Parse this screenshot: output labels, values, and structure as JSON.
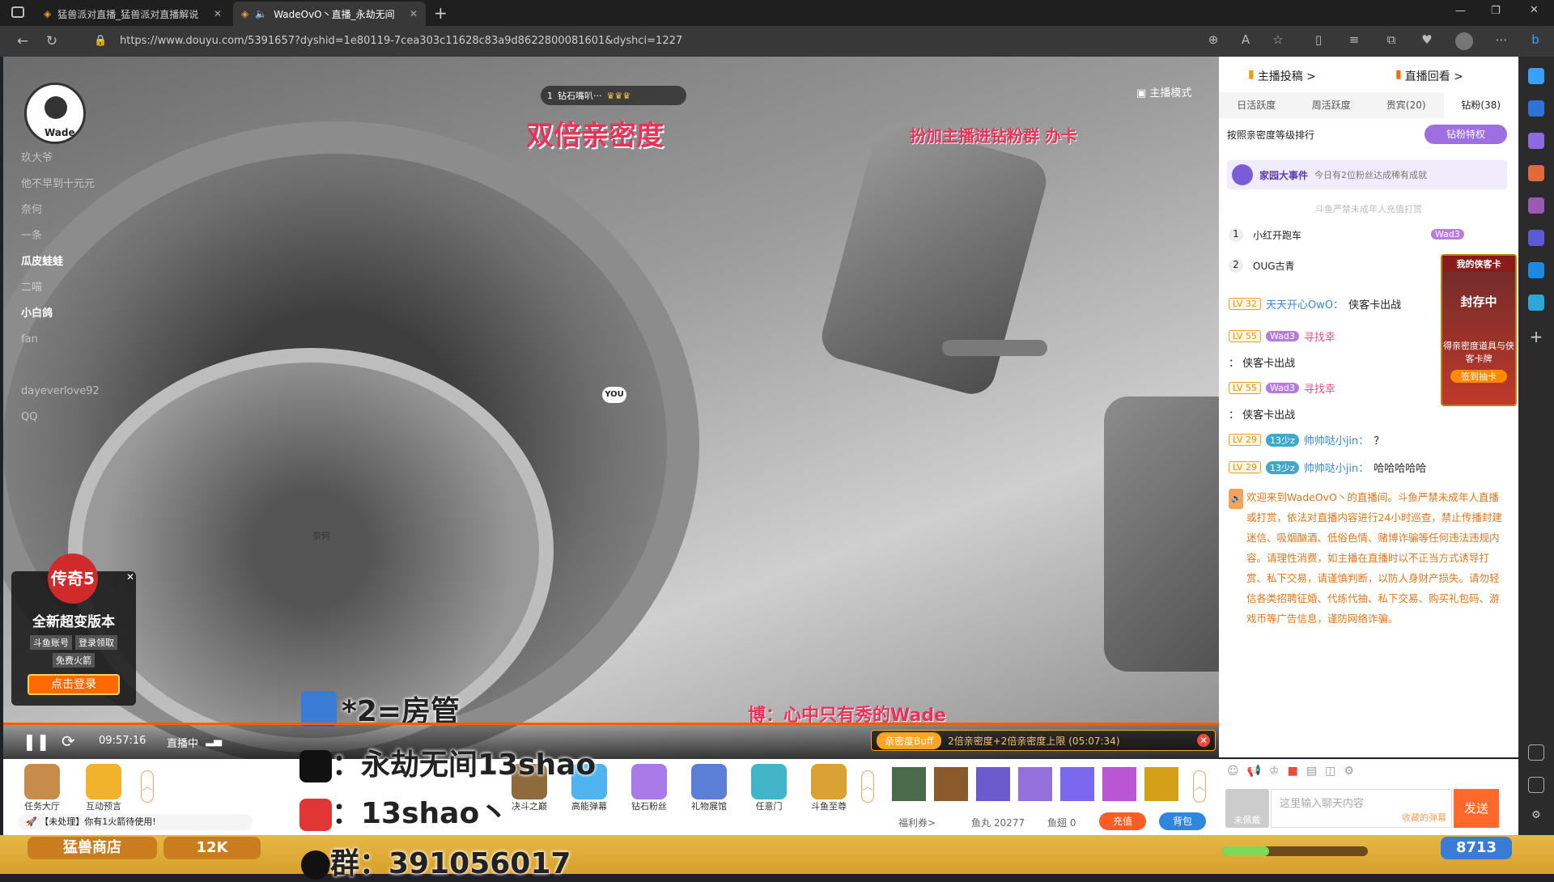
{
  "browser": {
    "tabs": [
      {
        "title": "猛兽派对直播_猛兽派对直播解说",
        "active": false
      },
      {
        "title": "WadeOvO丶直播_永劫无间",
        "active": true
      }
    ],
    "url": "https://www.douyu.com/5391657?dyshid=1e80119-7cea303c11628c83a9d8622800081601&dyshci=1227"
  },
  "video": {
    "streamer_name": "Wade",
    "rank_badge": "1",
    "rank_label": "钻石嘴叭···",
    "streamer_mode": "主播模式",
    "overlay_title": "双倍亲密度",
    "overlay_promo": "扮加主播进钻粉群 办卡",
    "you_label": "YOU",
    "viewer_names": [
      "玖大爷",
      "他不早到十元元",
      "奈何",
      "一条",
      "瓜皮蛙蛙",
      "二喵",
      "小白鸽",
      "fan",
      "dayeverlove92",
      "QQ"
    ],
    "highlight_names": [
      "瓜皮蛙蛙",
      "小白鸽"
    ],
    "subtitle_bottom": "博：心中只有秀的Wade",
    "time": "09:57:16",
    "live_status": "直播中",
    "danmu": [
      "*2=房管",
      "：永劫无间13shao",
      "：13shao丶",
      "群：391056017"
    ],
    "buff_tag": "亲密度Buff",
    "buff_text": "2倍亲密度+2倍亲密度上限 (05:07:34)",
    "nameplate": "奈何"
  },
  "promo_card": {
    "game": "传奇5",
    "title": "全新超变版本",
    "tags": [
      "斗鱼账号",
      "登录领取",
      "免费火箭"
    ],
    "button": "点击登录"
  },
  "panel": {
    "top_links": [
      "主播投稿 >",
      "直播回看 >"
    ],
    "tabs": [
      "日活跃度",
      "周活跃度",
      "贵宾(20)",
      "钻粉(38)"
    ],
    "sort_label": "按照亲密度等级排行",
    "diamond_btn": "钻粉特权",
    "event_title": "家园大事件",
    "event_text": "今日有2位粉丝达成稀有成就",
    "notice": "斗鱼严禁未成年人充值打赏",
    "ranks": [
      {
        "rank": "1",
        "name": "小红开跑车",
        "badge": "Wad3"
      },
      {
        "rank": "2",
        "name": "OUG古青",
        "badge": ""
      }
    ],
    "side_card": {
      "title": "我的侠客卡",
      "stamp": "封存中",
      "desc": "得亲密度道具与侠客卡牌",
      "btn": "签到抽卡"
    },
    "chat": [
      {
        "lv": "LV 32",
        "badge": "",
        "user": "天天开心OwO：",
        "text": "侠客卡出战"
      },
      {
        "lv": "LV 55",
        "badge": "Wad3",
        "user": "寻找幸",
        "text": ""
      },
      {
        "lv": "",
        "badge": "",
        "user": "",
        "text": "： 侠客卡出战"
      },
      {
        "lv": "LV 55",
        "badge": "Wad3",
        "user": "寻找幸",
        "text": ""
      },
      {
        "lv": "",
        "badge": "",
        "user": "",
        "text": "： 侠客卡出战"
      },
      {
        "lv": "LV 29",
        "badge": "13少z",
        "user": "帅帅哒小jin：",
        "text": "？"
      },
      {
        "lv": "LV 29",
        "badge": "13少z",
        "user": "帅帅哒小jin：",
        "text": "哈哈哈哈哈"
      }
    ],
    "welcome": "欢迎来到WadeOvO丶的直播间。斗鱼严禁未成年人直播或打赏，依法对直播内容进行24小时巡查，禁止传播封建迷信、吸烟酗酒、低俗色情、赌博诈骗等任何违法违规内容。请理性消费，如主播在直播时以不正当方式诱导打赏、私下交易，请谨慎判断，以防人身财产损失。请勿轻信各类招聘征婚、代练代抽、私下交易、购买礼包码、游戏币等广告信息，谨防网络诈骗。",
    "input_placeholder": "这里输入聊天内容",
    "unworn": "未佩戴",
    "collect_tag": "收藏的弹幕",
    "send": "发送"
  },
  "giftbar": {
    "left": [
      {
        "label": "任务大厅"
      },
      {
        "label": "互动预言"
      }
    ],
    "gifts": [
      {
        "label": "决斗之巅"
      },
      {
        "label": "高能弹幕"
      },
      {
        "label": "钻石粉丝"
      },
      {
        "label": "礼物展馆"
      },
      {
        "label": "任意门"
      },
      {
        "label": "斗鱼至尊"
      }
    ],
    "arrow_up": true,
    "notice": "【未处理】你有1火箭待使用!",
    "welfare": "福利券>",
    "fishball": "鱼丸 20277",
    "fishwing": "鱼翅 0",
    "recharge": "充值",
    "backpack": "背包"
  },
  "bottom_strip": {
    "items": [
      "猛兽商店",
      "12K"
    ],
    "right_value": "8713"
  }
}
